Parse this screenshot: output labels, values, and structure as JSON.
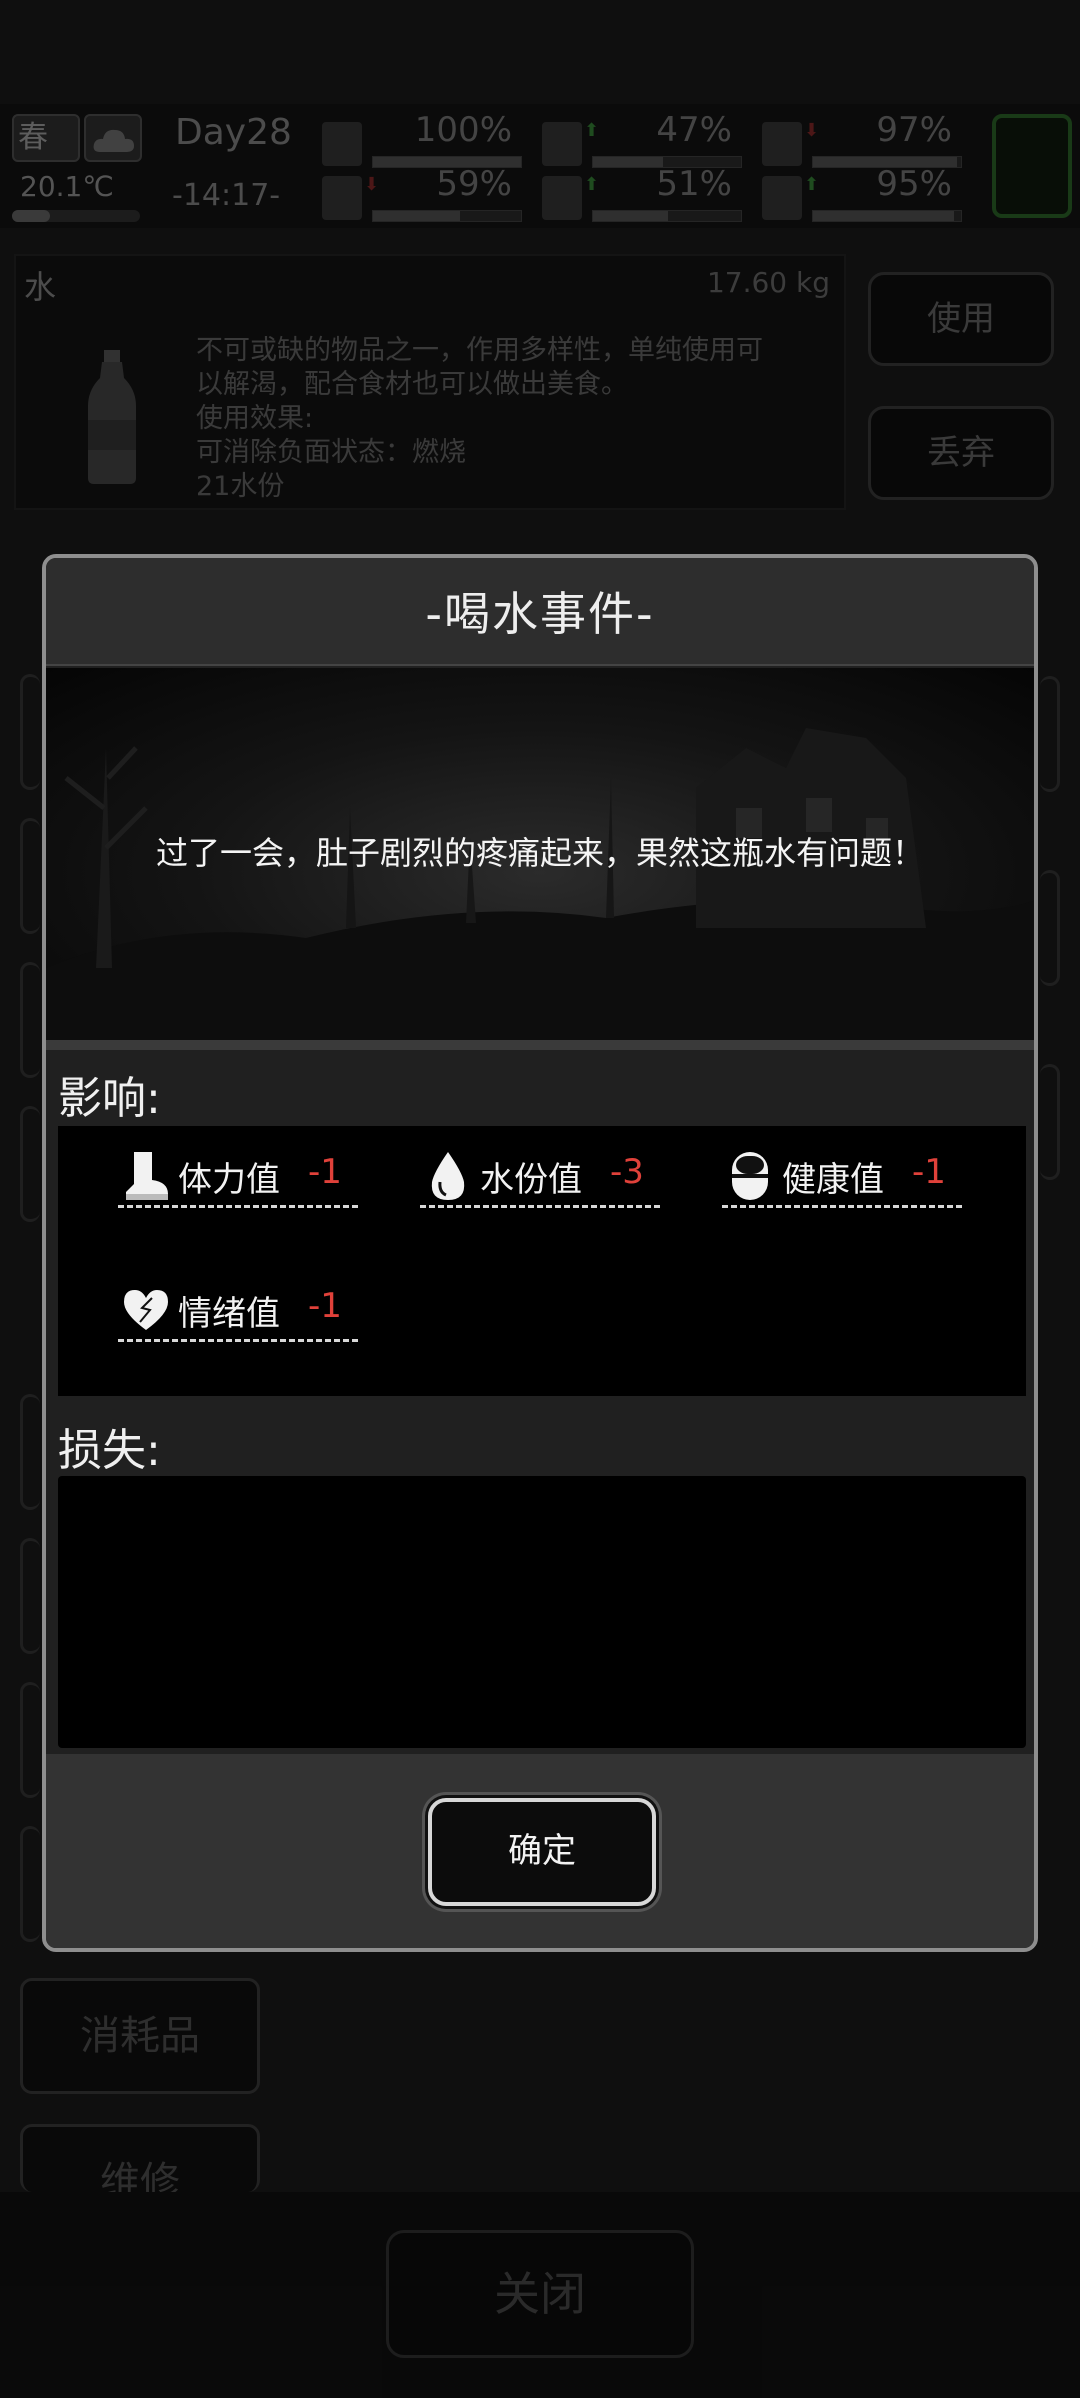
{
  "status": {
    "season": "春",
    "temperature": "20.1℃",
    "day": "Day28",
    "time": "-14:17-",
    "stats": [
      {
        "name": "medkit",
        "value": "100%",
        "fill": 1.0
      },
      {
        "name": "stomach",
        "value": "47%",
        "fill": 0.47
      },
      {
        "name": "pill",
        "value": "97%",
        "fill": 0.97
      },
      {
        "name": "boot",
        "value": "59%",
        "fill": 0.59
      },
      {
        "name": "water-drop",
        "value": "51%",
        "fill": 0.51
      },
      {
        "name": "heart",
        "value": "95%",
        "fill": 0.95
      }
    ]
  },
  "item": {
    "name": "水",
    "weight": "17.60 kg",
    "description": [
      "不可或缺的物品之一，作用多样性，单纯使用可",
      "以解渴，配合食材也可以做出美食。",
      "使用效果:",
      "可消除负面状态：燃烧",
      "21水份"
    ],
    "use_label": "使用",
    "discard_label": "丢弃"
  },
  "categories": {
    "consumables": "消耗品",
    "repair": "维修"
  },
  "close_label": "关闭",
  "dialog": {
    "title": "-喝水事件-",
    "event_text": "过了一会，肚子剧烈的疼痛起来，果然这瓶水有问题！",
    "effects_label": "影响:",
    "effects": [
      {
        "icon": "boot-icon",
        "label": "体力值",
        "value": "-1"
      },
      {
        "icon": "water-drop-icon",
        "label": "水份值",
        "value": "-3"
      },
      {
        "icon": "pill-icon",
        "label": "健康值",
        "value": "-1"
      },
      {
        "icon": "heart-icon",
        "label": "情绪值",
        "value": "-1"
      }
    ],
    "loss_label": "损失:",
    "confirm_label": "确定"
  },
  "colors": {
    "negative": "#e0413a",
    "dialog_border": "#8e8e8e"
  }
}
